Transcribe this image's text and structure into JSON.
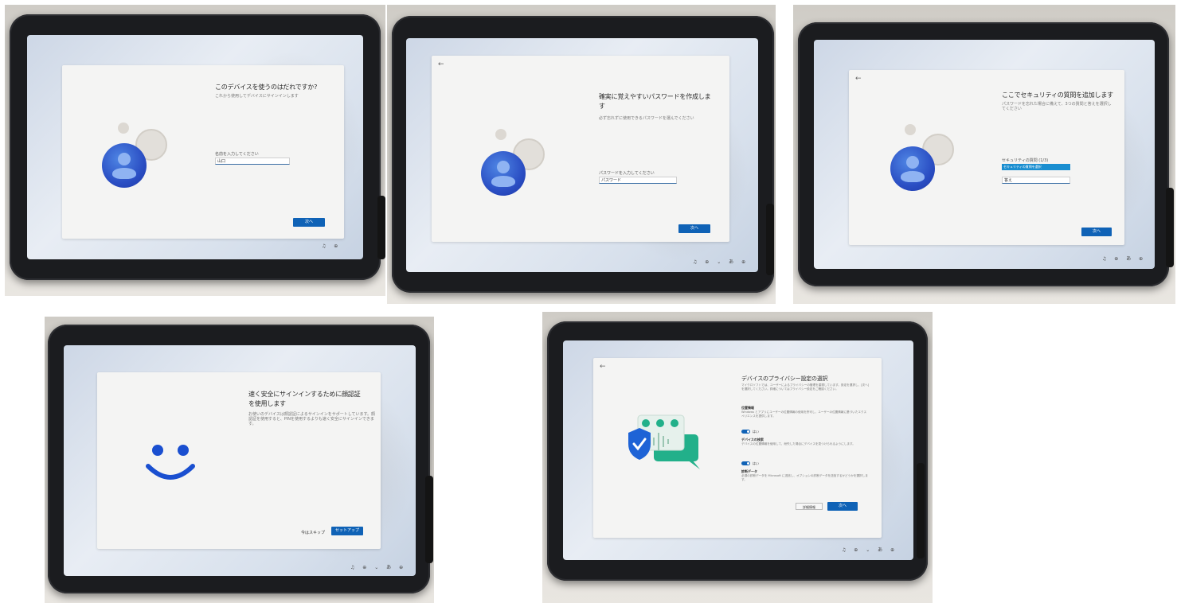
{
  "panel1": {
    "heading": "このデバイスを使うのはだれですか?",
    "subtext": "これから使用してデバイスにサインインします",
    "field_label": "名前を入力してください",
    "field_value": "山口",
    "next_button": "次へ",
    "taskbar_icons": "♫ ⊕"
  },
  "panel2": {
    "heading_line1": "確実に覚えやすいパスワードを作成しま",
    "heading_line2": "す",
    "subtext": "必ず忘れずに使用できるパスワードを選んでください",
    "field_label": "パスワードを入力してください",
    "field_value": "パスワード",
    "next_button": "次へ",
    "taskbar_icons": "♫ ⊕ ⌄ あ ⊕"
  },
  "panel3": {
    "heading": "ここでセキュリティの質問を追加します",
    "subtext": "パスワードを忘れた場合に備えて、3つの質問と答えを選択してください",
    "field_label": "セキュリティの質問 (1/3)",
    "dropdown_value": "セキュリティの質問を選択",
    "answer_value": "答え",
    "next_button": "次へ",
    "taskbar_icons": "♫ ⊕ あ ⊕"
  },
  "panel4": {
    "heading_line1": "速く安全にサインインするために顔認証",
    "heading_line2": "を使用します",
    "subtext": "お使いのデバイスは顔認証によるサインインをサポートしています。顔認証を使用すると、PINを使用するよりも速く安全にサインインできます。",
    "skip_link": "今はスキップ",
    "setup_button": "セットアップ",
    "taskbar_icons": "♫ ⊕ ⌄ あ ⊕"
  },
  "panel5": {
    "heading": "デバイスのプライバシー設定の選択",
    "subtext": "マイクロソフトでは、ユーザーによるプライバシーの管理を重視しています。設定を選択し、[次へ]を選択してください。詳細についてはプライバシー設定をご確認ください。",
    "section1": "位置情報",
    "section1_text": "Windows とアプリにユーザーの位置情報の使用を許可し、ユーザーの位置情報に基づいたエクスペリエンスを提供します。",
    "toggle1_label": "はい",
    "section2": "デバイスの検索",
    "section2_text": "デバイスの位置情報を使用して、紛失した場合にデバイスを見つけられるようにします。",
    "toggle2_label": "はい",
    "section3": "診断データ",
    "section3_text": "必須の診断データを Microsoft に送信し、オプションの診断データを送信するかどうかを選択します。",
    "more_button": "詳細情報",
    "accept_button": "次へ",
    "taskbar_icons": "♫ ⊕ ⌄ あ ⊕"
  },
  "colors": {
    "accent": "#0f62b6",
    "avatar": "#2b4fc4",
    "face_icon": "#1a4fd0",
    "shield": "#1e63d6",
    "chat": "#22b08a"
  }
}
